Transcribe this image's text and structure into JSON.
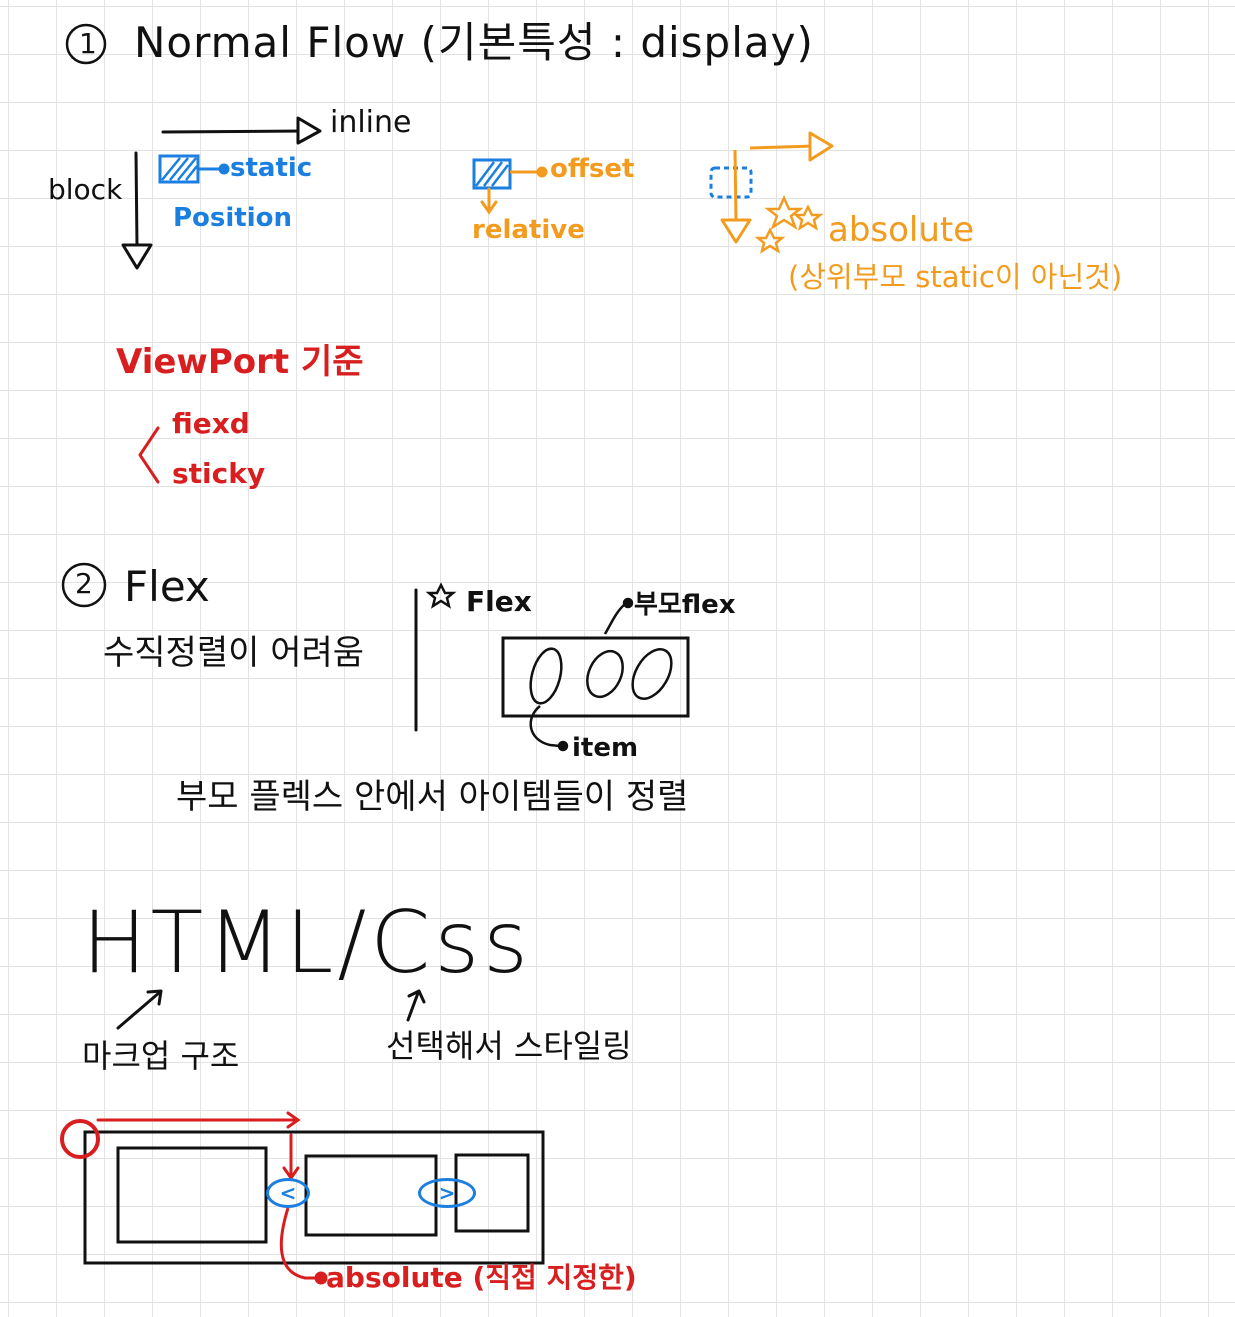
{
  "colors": {
    "black": "#111111",
    "blue": "#1a7fe0",
    "orange": "#f39b1e",
    "red": "#d81e1e",
    "grid": "#e3e3e3"
  },
  "section1": {
    "number": "1",
    "title": "Normal Flow (기본특성 : display)",
    "axis_inline": "inline",
    "axis_block": "block",
    "static_label": "static",
    "position_label": "Position",
    "offset_label": "offset",
    "relative_label": "relative",
    "absolute_label": "absolute",
    "absolute_note": "(상위부모 static이 아닌것)",
    "viewport_label": "ViewPort 기준",
    "fixed_label": "fiexd",
    "sticky_label": "sticky"
  },
  "section2": {
    "number": "2",
    "title": "Flex",
    "note": "수직정렬이 어려움",
    "flex_label": "Flex",
    "parent_flex_label": "부모flex",
    "item_label": "item",
    "caption": "부모 플렉스 안에서 아이템들이 정렬"
  },
  "section3": {
    "title": "HTML/Css",
    "html_note": "마크업 구조",
    "css_note": "선택해서 스타일링",
    "prev_glyph": "<",
    "next_glyph": ">",
    "absolute_note": "absolute (직접 지정한)"
  },
  "icons": [
    "star-icon"
  ]
}
